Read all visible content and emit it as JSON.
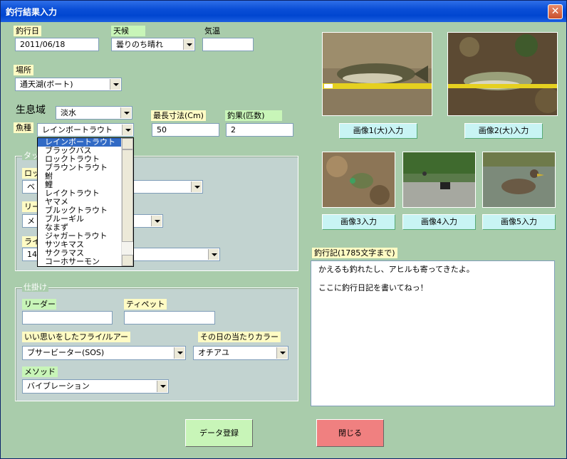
{
  "window": {
    "title": "釣行結果入力",
    "close": "✕"
  },
  "fields": {
    "date_label": "釣行日",
    "date_value": "2011/06/18",
    "weather_label": "天候",
    "weather_value": "曇りのち晴れ",
    "temp_label": "気温",
    "temp_value": "",
    "place_label": "場所",
    "place_value": "通天湖(ボート)",
    "habitat_label": "生息域",
    "habitat_value": "淡水",
    "species_label": "魚種",
    "species_value": "レインボートラウト",
    "maxlen_label": "最長寸法(Cm)",
    "maxlen_value": "50",
    "catch_label": "釣果(匹数)",
    "catch_value": "2"
  },
  "tackle": {
    "group_label": "タック",
    "rod_label": "ロッ",
    "rod_value": "ベ",
    "reel_label": "リー",
    "reel_value": "メ",
    "line_label": "ライ",
    "line_value": "14"
  },
  "rig": {
    "group_label": "仕掛け",
    "leader_label": "リーダー",
    "leader_value": "",
    "tippet_label": "ティペット",
    "tippet_value": "",
    "fly_label": "いい思いをしたフライ/ルアー",
    "fly_value": "ブサービーター(SOS)",
    "color_label": "その日の当たりカラー",
    "color_value": "オチアユ",
    "method_label": "メソッド",
    "method_value": "バイブレーション"
  },
  "species_dropdown": {
    "options": [
      "レインボートラウト",
      "ブラックバス",
      "ロックトラウト",
      "ブラウントラウト",
      "鮒",
      "鯉",
      "レイクトラウト",
      "ヤマメ",
      "ブルックトラウト",
      "ブルーギル",
      "なまず",
      "ジャガートラウト",
      "サツキマス",
      "サクラマス",
      "コーホサーモン"
    ],
    "selected_index": 0
  },
  "images": {
    "btn1": "画像1(大)入力",
    "btn2": "画像2(大)入力",
    "btn3": "画像3入力",
    "btn4": "画像4入力",
    "btn5": "画像5入力"
  },
  "journal": {
    "label": "釣行記(1785文字まで)",
    "line1": "かえるも釣れたし、アヒルも寄ってきたよ。",
    "line2": "ここに釣行日記を書いてねっ！"
  },
  "buttons": {
    "register": "データ登録",
    "close": "閉じる"
  },
  "colors": {
    "register_bg": "#c8f5b8",
    "close_bg": "#f08080",
    "form_bg": "#a9ccab"
  }
}
